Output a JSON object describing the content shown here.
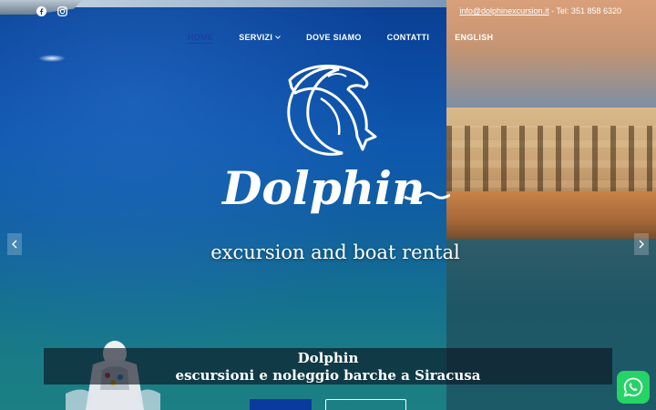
{
  "topbar": {
    "social": [
      "facebook-icon",
      "instagram-icon"
    ],
    "email": "info@dolphinexcursion.it",
    "phone_text": " - Tel: 351 858 6320"
  },
  "nav": {
    "items": [
      {
        "label": "HOME",
        "active": true
      },
      {
        "label": "SERVIZI",
        "has_dropdown": true
      },
      {
        "label": "DOVE SIAMO"
      },
      {
        "label": "CONTATTI"
      },
      {
        "label": "ENGLISH"
      }
    ],
    "active_color": "#1a3ea8"
  },
  "hero": {
    "logo_text": "Dolphin",
    "tagline": "excursion and boat rental",
    "caption_title": "Dolphin",
    "caption_subtitle": "escursioni e noleggio barche a Siracusa"
  },
  "slider": {
    "prev_icon": "chevron-left-icon",
    "next_icon": "chevron-right-icon"
  },
  "buttons": {
    "primary_color": "#0a3a9e"
  },
  "chat": {
    "icon": "whatsapp-icon",
    "color": "#25d366"
  }
}
